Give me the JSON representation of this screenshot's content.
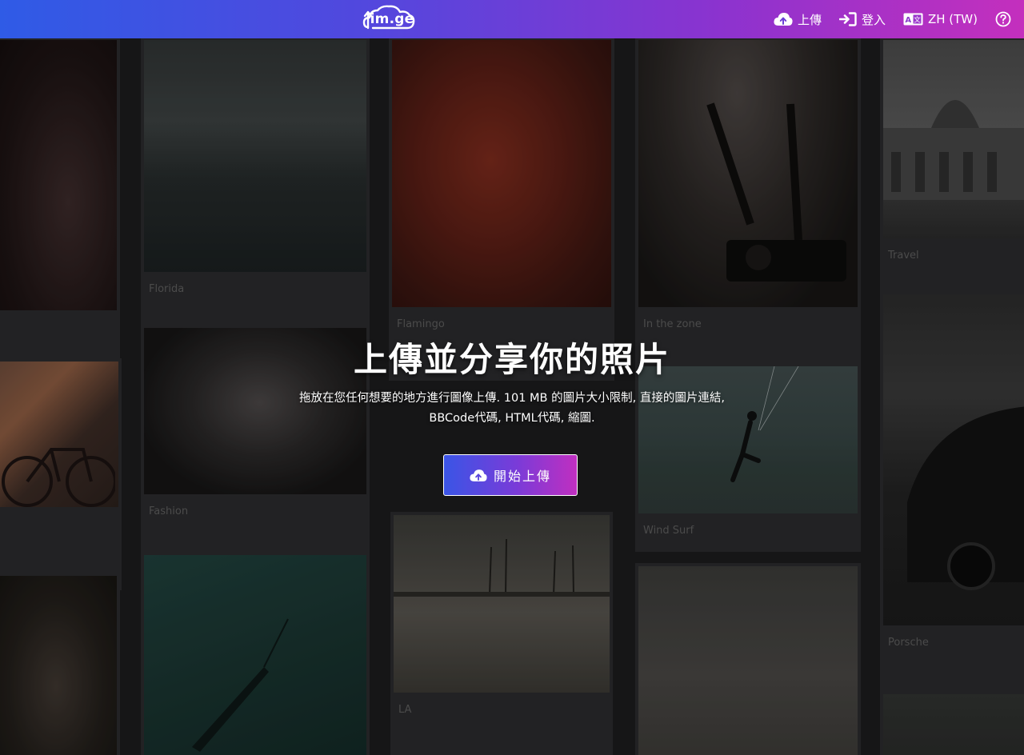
{
  "header": {
    "logo_text": "im.ge",
    "upload_label": "上傳",
    "login_label": "登入",
    "language_label": "ZH (TW)"
  },
  "hero": {
    "title": "上傳並分享你的照片",
    "description": "拖放在您任何想要的地方進行圖像上傳. 101 MB 的圖片大小限制, 直接的圖片連結, BBCode代碼, HTML代碼, 縮圖.",
    "cta_label": "開始上傳"
  },
  "gallery": {
    "captions": {
      "florida": "Florida",
      "flamingo": "Flamingo",
      "in_the_zone": "In the zone",
      "travel": "Travel",
      "fashion": "Fashion",
      "wind_surf": "Wind Surf",
      "porsche": "Porsche",
      "la": "LA"
    }
  },
  "colors": {
    "header_gradient_start": "#2f5be6",
    "header_gradient_end": "#c42fbd",
    "cta_border": "#ffffff"
  },
  "icons": [
    "cloud-upload-icon",
    "login-icon",
    "translate-icon",
    "help-icon"
  ]
}
